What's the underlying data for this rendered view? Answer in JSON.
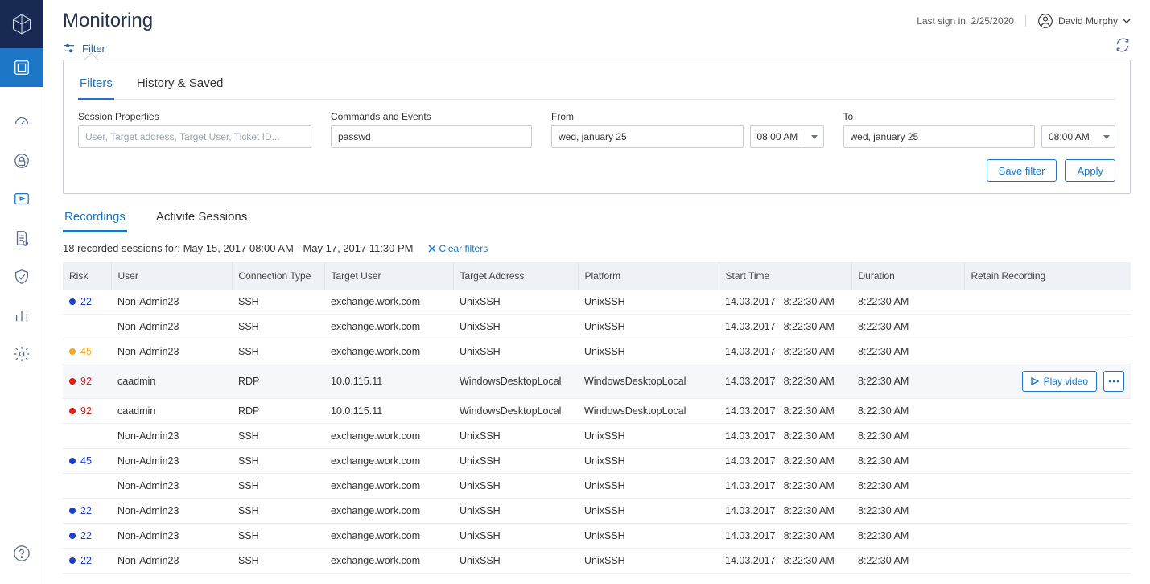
{
  "header": {
    "title": "Monitoring",
    "last_signin_label": "Last sign in: 2/25/2020",
    "user_name": "David Murphy"
  },
  "filter_toggle": {
    "label": "Filter"
  },
  "filter_panel": {
    "tabs": {
      "filters": "Filters",
      "history": "History & Saved"
    },
    "session_props": {
      "label": "Session Properties",
      "placeholder": "User, Target address, Target User, Ticket ID..."
    },
    "commands": {
      "label": "Commands and Events",
      "value": "passwd"
    },
    "from": {
      "label": "From",
      "date": "wed, january 25",
      "time": "08:00 AM"
    },
    "to": {
      "label": "To",
      "date": "wed, january 25",
      "time": "08:00 AM"
    },
    "save_label": "Save filter",
    "apply_label": "Apply"
  },
  "view_tabs": {
    "recordings": "Recordings",
    "active": "Activite Sessions"
  },
  "summary_text": "18 recorded sessions for: May 15, 2017 08:00 AM - May 17, 2017 11:30 PM",
  "clear_filters": "Clear filters",
  "columns": {
    "risk": "Risk",
    "user": "User",
    "conn": "Connection Type",
    "tuser": "Target User",
    "taddr": "Target Address",
    "platform": "Platform",
    "start": "Start Time",
    "dur": "Duration",
    "retain": "Retain Recording"
  },
  "play_label": "Play video",
  "rows": [
    {
      "risk": "22",
      "riskcolor": "blue",
      "user": "Non-Admin23",
      "conn": "SSH",
      "tuser": "exchange.work.com",
      "taddr": "UnixSSH",
      "platform": "UnixSSH",
      "date": "14.03.2017",
      "time": "8:22:30 AM",
      "dur": "8:22:30 AM",
      "hover": false
    },
    {
      "risk": "",
      "riskcolor": "",
      "user": "Non-Admin23",
      "conn": "SSH",
      "tuser": "exchange.work.com",
      "taddr": "UnixSSH",
      "platform": "UnixSSH",
      "date": "14.03.2017",
      "time": "8:22:30 AM",
      "dur": "8:22:30 AM",
      "hover": false
    },
    {
      "risk": "45",
      "riskcolor": "orange",
      "user": "Non-Admin23",
      "conn": "SSH",
      "tuser": "exchange.work.com",
      "taddr": "UnixSSH",
      "platform": "UnixSSH",
      "date": "14.03.2017",
      "time": "8:22:30 AM",
      "dur": "8:22:30 AM",
      "hover": false
    },
    {
      "risk": "92",
      "riskcolor": "red",
      "user": "caadmin",
      "conn": "RDP",
      "tuser": "10.0.115.11",
      "taddr": "WindowsDesktopLocal",
      "platform": "WindowsDesktopLocal",
      "date": "14.03.2017",
      "time": "8:22:30 AM",
      "dur": "8:22:30 AM",
      "hover": true
    },
    {
      "risk": "92",
      "riskcolor": "red",
      "user": "caadmin",
      "conn": "RDP",
      "tuser": "10.0.115.11",
      "taddr": "WindowsDesktopLocal",
      "platform": "WindowsDesktopLocal",
      "date": "14.03.2017",
      "time": "8:22:30 AM",
      "dur": "8:22:30 AM",
      "hover": false
    },
    {
      "risk": "",
      "riskcolor": "",
      "user": "Non-Admin23",
      "conn": "SSH",
      "tuser": "exchange.work.com",
      "taddr": "UnixSSH",
      "platform": "UnixSSH",
      "date": "14.03.2017",
      "time": "8:22:30 AM",
      "dur": "8:22:30 AM",
      "hover": false
    },
    {
      "risk": "45",
      "riskcolor": "blue",
      "user": "Non-Admin23",
      "conn": "SSH",
      "tuser": "exchange.work.com",
      "taddr": "UnixSSH",
      "platform": "UnixSSH",
      "date": "14.03.2017",
      "time": "8:22:30 AM",
      "dur": "8:22:30 AM",
      "hover": false
    },
    {
      "risk": "",
      "riskcolor": "",
      "user": "Non-Admin23",
      "conn": "SSH",
      "tuser": "exchange.work.com",
      "taddr": "UnixSSH",
      "platform": "UnixSSH",
      "date": "14.03.2017",
      "time": "8:22:30 AM",
      "dur": "8:22:30 AM",
      "hover": false
    },
    {
      "risk": "22",
      "riskcolor": "blue",
      "user": "Non-Admin23",
      "conn": "SSH",
      "tuser": "exchange.work.com",
      "taddr": "UnixSSH",
      "platform": "UnixSSH",
      "date": "14.03.2017",
      "time": "8:22:30 AM",
      "dur": "8:22:30 AM",
      "hover": false
    },
    {
      "risk": "22",
      "riskcolor": "blue",
      "user": "Non-Admin23",
      "conn": "SSH",
      "tuser": "exchange.work.com",
      "taddr": "UnixSSH",
      "platform": "UnixSSH",
      "date": "14.03.2017",
      "time": "8:22:30 AM",
      "dur": "8:22:30 AM",
      "hover": false
    },
    {
      "risk": "22",
      "riskcolor": "blue",
      "user": "Non-Admin23",
      "conn": "SSH",
      "tuser": "exchange.work.com",
      "taddr": "UnixSSH",
      "platform": "UnixSSH",
      "date": "14.03.2017",
      "time": "8:22:30 AM",
      "dur": "8:22:30 AM",
      "hover": false
    }
  ]
}
